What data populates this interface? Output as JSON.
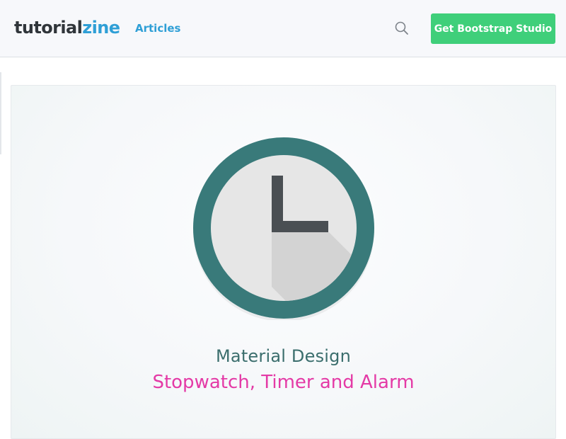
{
  "header": {
    "logo_part1": "tutorial",
    "logo_part2": "zine",
    "nav_articles": "Articles",
    "search_icon": "search-icon",
    "cta_label": "Get Bootstrap Studio"
  },
  "hero": {
    "image_icon": "clock-icon",
    "subtitle": "Material Design",
    "title": "Stopwatch, Timer and Alarm"
  },
  "colors": {
    "brand_dark": "#30353a",
    "brand_blue": "#2f9fd6",
    "cta_green": "#3fcf7a",
    "clock_ring": "#397a7a",
    "subtitle": "#3b6e6d",
    "title_pink": "#e43aa6"
  }
}
